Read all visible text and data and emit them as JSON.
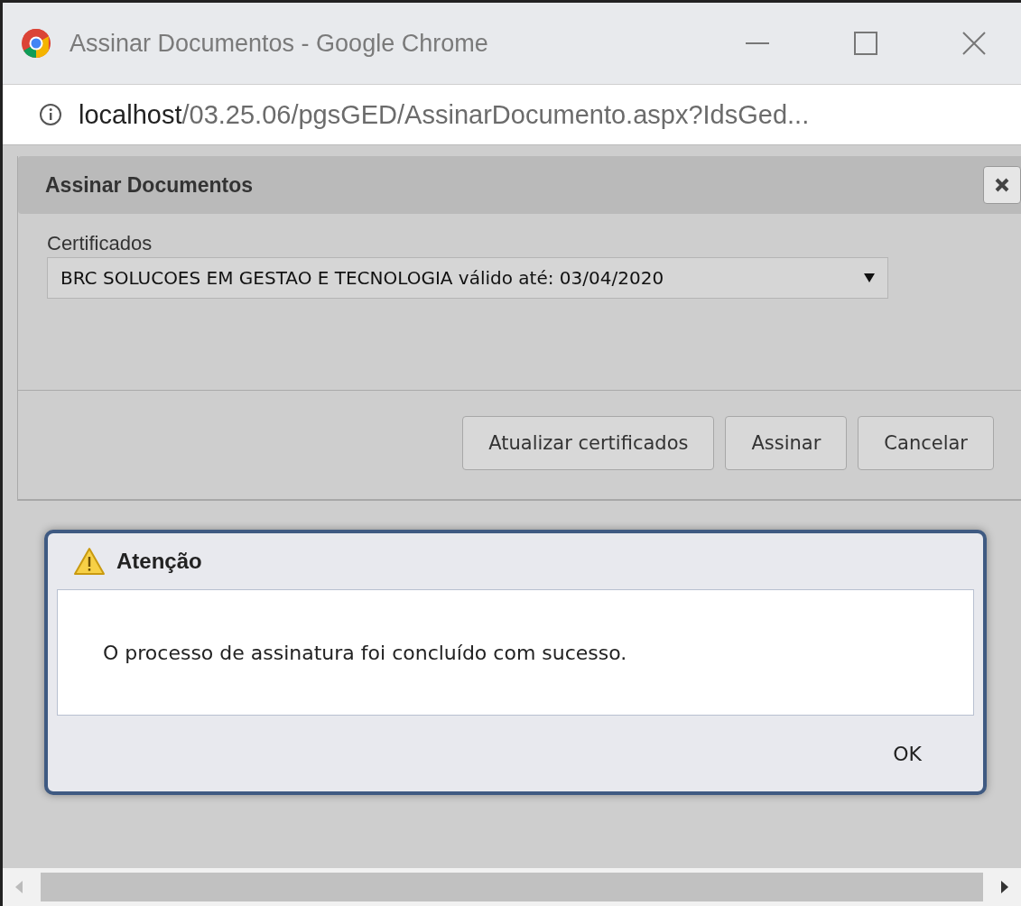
{
  "browser_window": {
    "title": "Assinar Documentos - Google Chrome",
    "url_host": "localhost",
    "url_path": "/03.25.06/pgsGED/AssinarDocumento.aspx?IdsGed..."
  },
  "panel": {
    "title": "Assinar Documentos",
    "field_label": "Certificados",
    "certificate_value": "BRC SOLUCOES EM GESTAO E TECNOLOGIA válido até: 03/04/2020",
    "buttons": [
      "Atualizar certificados",
      "Assinar",
      "Cancelar"
    ]
  },
  "dialog": {
    "title": "Atenção",
    "message": "O processo de assinatura foi concluído com sucesso.",
    "button": "OK"
  }
}
